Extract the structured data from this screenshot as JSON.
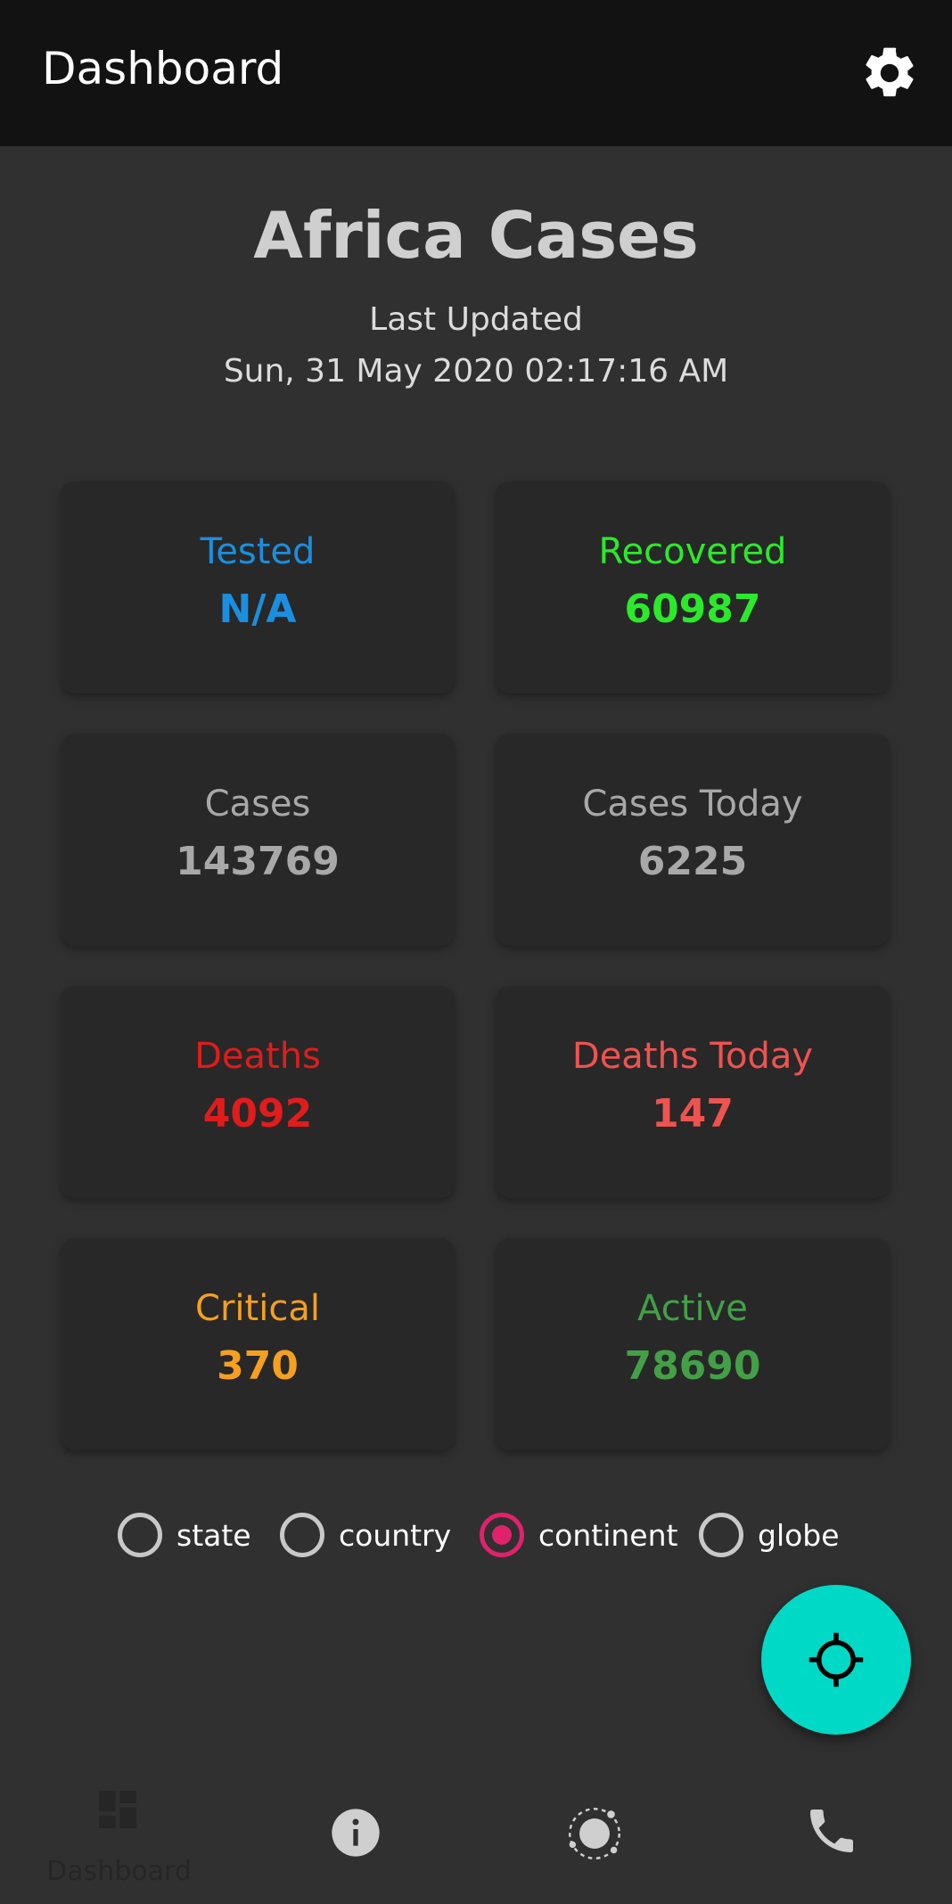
{
  "appbar": {
    "title": "Dashboard"
  },
  "header": {
    "title": "Africa Cases",
    "updated_label": "Last Updated",
    "updated_time": "Sun, 31 May 2020 02:17:16 AM"
  },
  "stats": [
    {
      "label": "Tested",
      "value": "N/A",
      "color": "#1a8fe0"
    },
    {
      "label": "Recovered",
      "value": "60987",
      "color": "#2bea2b"
    },
    {
      "label": "Cases",
      "value": "143769",
      "color": "#a8a8a8"
    },
    {
      "label": "Cases Today",
      "value": "6225",
      "color": "#a8a8a8"
    },
    {
      "label": "Deaths",
      "value": "4092",
      "color": "#e01c1c"
    },
    {
      "label": "Deaths Today",
      "value": "147",
      "color": "#ef5350"
    },
    {
      "label": "Critical",
      "value": "370",
      "color": "#f5a020"
    },
    {
      "label": "Active",
      "value": "78690",
      "color": "#43a047"
    }
  ],
  "scope_options": {
    "selected": "continent",
    "items": [
      "state",
      "country",
      "continent",
      "globe"
    ]
  },
  "fab": {
    "icon": "gps-target-icon",
    "color": "#00d9c6"
  },
  "bottom_nav": {
    "items": [
      {
        "label": "Dashboard",
        "icon": "dashboard-icon",
        "active": true
      },
      {
        "label": "",
        "icon": "info-icon"
      },
      {
        "label": "",
        "icon": "globe-orbit-icon"
      },
      {
        "label": "",
        "icon": "phone-icon"
      }
    ]
  },
  "colors": {
    "accent": "#e0216b",
    "appbar": "#121212",
    "background": "#303030"
  }
}
